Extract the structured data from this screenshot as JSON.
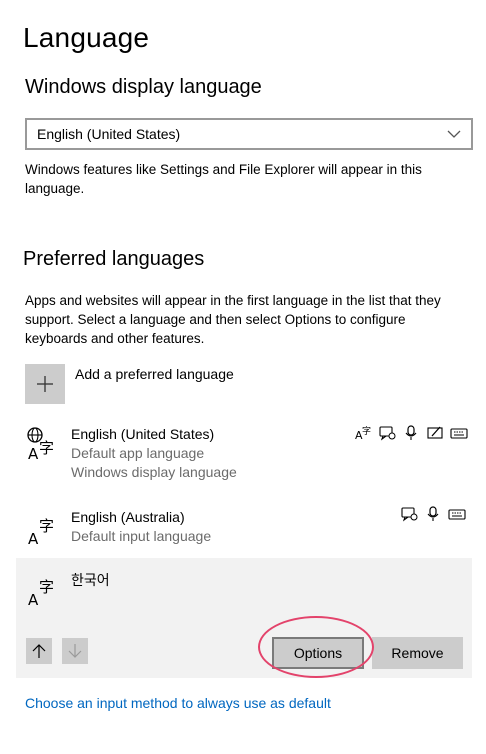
{
  "page": {
    "title": "Language"
  },
  "display_language": {
    "heading": "Windows display language",
    "selected": "English (United States)",
    "description_line1": "Windows features like Settings and File Explorer will appear in this",
    "description_line2": "language."
  },
  "preferred": {
    "heading": "Preferred languages",
    "description_line1": "Apps and websites will appear in the first language in the list that they",
    "description_line2": "support. Select a language and then select Options to configure",
    "description_line3": "keyboards and other features.",
    "add_label": "Add a preferred language",
    "languages": [
      {
        "name": "English (United States)",
        "sub1": "Default app language",
        "sub2": "Windows display language",
        "features": [
          "display-language-icon",
          "text-to-speech-icon",
          "speech-recognition-icon",
          "handwriting-icon",
          "keyboard-icon"
        ]
      },
      {
        "name": "English (Australia)",
        "sub1": "Default input language",
        "features": [
          "text-to-speech-icon",
          "speech-recognition-icon",
          "keyboard-icon"
        ]
      },
      {
        "name": "한국어",
        "selected": true
      }
    ],
    "options_label": "Options",
    "remove_label": "Remove"
  },
  "footer": {
    "link": "Choose an input method to always use as default"
  },
  "colors": {
    "accent_link": "#0067c0",
    "button_bg": "#cccccc",
    "selected_bg": "#f2f2f2",
    "annotation_red": "#e3436b"
  }
}
